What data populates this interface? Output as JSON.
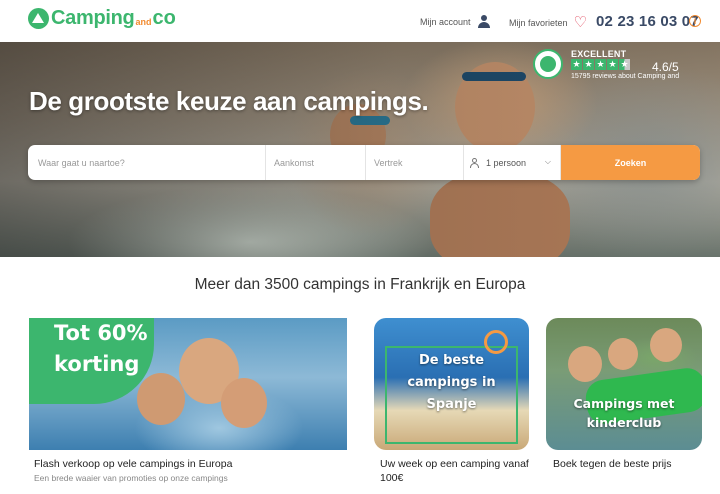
{
  "header": {
    "logo_main": "Camping",
    "logo_and": "and",
    "logo_co": "co",
    "account_label": "Mijn account",
    "favorites_label": "Mijn favorieten",
    "phone": "02 23 16 03 07",
    "info_glyph": "i"
  },
  "hero": {
    "title": "De grootste keuze aan campings.",
    "rating": {
      "label": "EXCELLENT",
      "score": "4.6/5",
      "stars": 4.5,
      "reviews": "15795 reviews about Camping and"
    }
  },
  "search": {
    "destination_placeholder": "Waar gaat u naartoe?",
    "arrival_placeholder": "Aankomst",
    "departure_placeholder": "Vertrek",
    "persons_value": "1 persoon",
    "button_label": "Zoeken"
  },
  "tagline": "Meer dan 3500 campings in Frankrijk en Europa",
  "cards": [
    {
      "overlay_line1": "Tot 60%",
      "overlay_line2": "korting",
      "title": "Flash verkoop op vele campings in Europa",
      "subtitle": "Een brede waaier van promoties op onze campings"
    },
    {
      "overlay_line1": "De beste",
      "overlay_line2": "campings in",
      "overlay_line3": "Spanje",
      "title": "Uw week op een camping vanaf 100€"
    },
    {
      "overlay_line1": "Campings met",
      "overlay_line2": "kinderclub",
      "title": "Boek tegen de beste prijs"
    }
  ],
  "colors": {
    "brand_green": "#3cb66e",
    "brand_orange": "#f59a43",
    "heart_red": "#e0455a",
    "navy": "#3a4a66"
  },
  "icons": [
    "logo-tent-icon",
    "user-icon",
    "heart-icon",
    "info-icon",
    "trustpilot-badge-icon",
    "person-icon",
    "chevron-down-icon",
    "sun-icon"
  ]
}
